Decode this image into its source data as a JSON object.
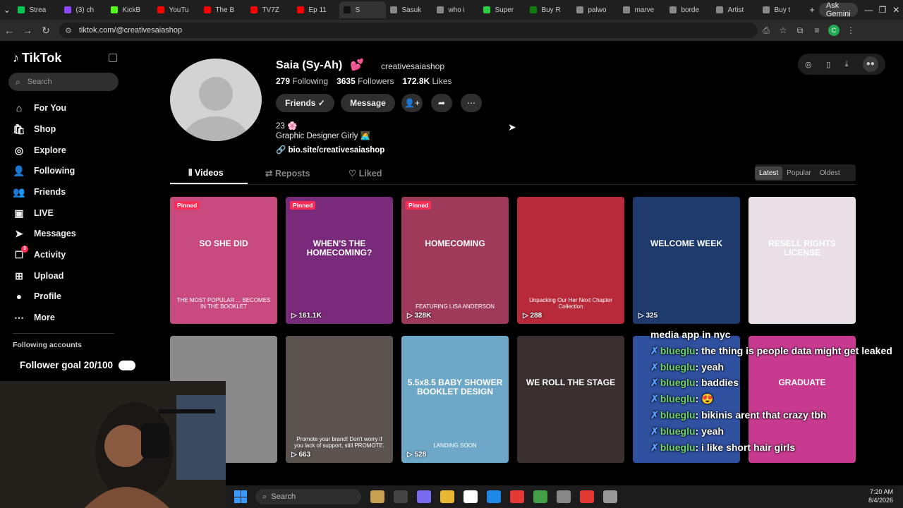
{
  "browser": {
    "tabs": [
      {
        "label": "Strea",
        "color": "#00c853"
      },
      {
        "label": "(3) ch",
        "color": "#9146ff"
      },
      {
        "label": "KickB",
        "color": "#53fc18"
      },
      {
        "label": "YouTu",
        "color": "#ff0000"
      },
      {
        "label": "The B",
        "color": "#ff0000"
      },
      {
        "label": "TV7Z",
        "color": "#ff0000"
      },
      {
        "label": "Ep 11",
        "color": "#ff0000"
      },
      {
        "label": "S",
        "color": "#111111"
      },
      {
        "label": "Sasuk",
        "color": "#888888"
      },
      {
        "label": "who i",
        "color": "#888888"
      },
      {
        "label": "Super",
        "color": "#2ecc40"
      },
      {
        "label": "Buy R",
        "color": "#107c10"
      },
      {
        "label": "palwo",
        "color": "#888888"
      },
      {
        "label": "marve",
        "color": "#888888"
      },
      {
        "label": "borde",
        "color": "#888888"
      },
      {
        "label": "Artist",
        "color": "#888888"
      },
      {
        "label": "Buy t",
        "color": "#888888"
      }
    ],
    "ask_gemini": "Ask Gemini",
    "url": "tiktok.com/@creativesaiashop"
  },
  "sidebar": {
    "logo": "TikTok",
    "search_placeholder": "Search",
    "items": [
      {
        "label": "For You",
        "icon": "⌂"
      },
      {
        "label": "Shop",
        "icon": "🛍"
      },
      {
        "label": "Explore",
        "icon": "◎"
      },
      {
        "label": "Following",
        "icon": "👤"
      },
      {
        "label": "Friends",
        "icon": "👥"
      },
      {
        "label": "LIVE",
        "icon": "▣"
      },
      {
        "label": "Messages",
        "icon": "➤"
      },
      {
        "label": "Activity",
        "icon": "☐",
        "badge": "3"
      },
      {
        "label": "Upload",
        "icon": "⊞"
      },
      {
        "label": "Profile",
        "icon": "●"
      },
      {
        "label": "More",
        "icon": "⋯"
      }
    ],
    "following_accounts": "Following accounts"
  },
  "profile": {
    "display_name": "Saia (Sy-Ah)",
    "heart": "💕",
    "username": "creativesaiashop",
    "following_count": "279",
    "following_label": "Following",
    "followers_count": "3635",
    "followers_label": "Followers",
    "likes_count": "172.8K",
    "likes_label": "Likes",
    "friends_button": "Friends ✓",
    "message_button": "Message",
    "age": "23 🌸",
    "bio": "Graphic Designer Girly 👩‍💻",
    "link": "bio.site/creativesaiashop"
  },
  "tabs": {
    "videos": "Videos",
    "reposts": "Reposts",
    "liked": "Liked"
  },
  "sort": {
    "latest": "Latest",
    "popular": "Popular",
    "oldest": "Oldest"
  },
  "videos": [
    {
      "views": "",
      "pinned": "Pinned",
      "bg": "#c84a7e",
      "title": "SO SHE DID",
      "caption": "THE MOST POPULAR ... BECOMES IN THE BOOKLET"
    },
    {
      "views": "161.1K",
      "pinned": "Pinned",
      "bg": "#7a2a7a",
      "title": "WHEN'S THE HOMECOMING?",
      "caption": ""
    },
    {
      "views": "328K",
      "pinned": "Pinned",
      "bg": "#a03a5a",
      "title": "HOMECOMING",
      "caption": "FEATURING LISA ANDERSON"
    },
    {
      "views": "288",
      "pinned": "",
      "bg": "#b8293a",
      "title": "",
      "caption": "Unpacking Our Her Next Chapter Collection"
    },
    {
      "views": "325",
      "pinned": "",
      "bg": "#1f3b6e",
      "title": "WELCOME WEEK",
      "caption": ""
    },
    {
      "views": "",
      "pinned": "",
      "bg": "#e8e0e6",
      "title": "RESELL RIGHTS LICENSE",
      "caption": ""
    },
    {
      "views": "",
      "pinned": "",
      "bg": "#8a8a8a",
      "title": "",
      "caption": ""
    },
    {
      "views": "663",
      "pinned": "",
      "bg": "#5a5350",
      "title": "",
      "caption": "Promote your brand! Don't worry if you lack of support, still PROMOTE."
    },
    {
      "views": "528",
      "pinned": "",
      "bg": "#6ea8c8",
      "title": "5.5x8.5 BABY SHOWER BOOKLET DESIGN",
      "caption": "LANDING SOON"
    },
    {
      "views": "",
      "pinned": "",
      "bg": "#3a3030",
      "title": "WE ROLL THE STAGE",
      "caption": ""
    },
    {
      "views": "",
      "pinned": "",
      "bg": "#3050a0",
      "title": "",
      "caption": ""
    },
    {
      "views": "",
      "pinned": "",
      "bg": "#c83a90",
      "title": "GRADUATE",
      "caption": ""
    }
  ],
  "overlay": {
    "follower_goal": "Follower goal 20/100",
    "chat": [
      {
        "user": "",
        "text": "media app in nyc"
      },
      {
        "user": "blueglu",
        "text": "the thing is people data might get leaked"
      },
      {
        "user": "blueglu",
        "text": "yeah"
      },
      {
        "user": "blueglu",
        "text": "baddies"
      },
      {
        "user": "blueglu",
        "text": "😍"
      },
      {
        "user": "blueglu",
        "text": "bikinis arent that crazy tbh"
      },
      {
        "user": "blueglu",
        "text": "yeah"
      },
      {
        "user": "blueglu",
        "text": "i like short hair girls"
      }
    ]
  },
  "taskbar": {
    "search": "Search",
    "time": "7:20 AM",
    "date": "8/4/2026"
  }
}
